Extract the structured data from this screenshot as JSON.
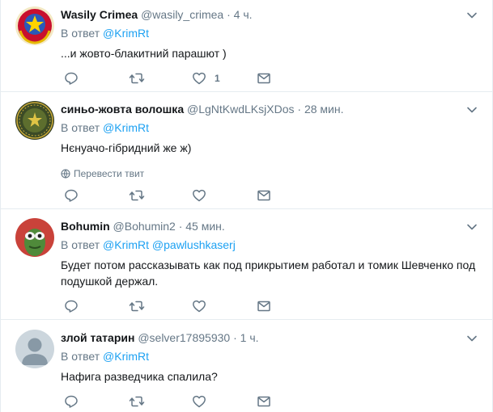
{
  "tweets": [
    {
      "name": "Wasily Crimea",
      "handle": "@wasily_crimea",
      "time": "4 ч.",
      "reply_prefix": "В ответ",
      "reply_to": [
        "@KrimRt"
      ],
      "text": "...и жовто-блакитний парашют )",
      "likes": "1"
    },
    {
      "name": "синьо-жовта волошка",
      "handle": "@LgNtKwdLKsjXDos",
      "time": "28 мин.",
      "reply_prefix": "В ответ",
      "reply_to": [
        "@KrimRt"
      ],
      "text": "Нєнуачо-гібридний же ж)",
      "translate": "Перевести твит"
    },
    {
      "name": "Bohumin",
      "handle": "@Bohumin2",
      "time": "45 мин.",
      "reply_prefix": "В ответ",
      "reply_to": [
        "@KrimRt",
        "@pawlushkaserj"
      ],
      "text": "Будет потом рассказывать как под прикрытием работал и томик Шевченко под подушкой держал."
    },
    {
      "name": "злой татарин",
      "handle": "@selver17895930",
      "time": "1 ч.",
      "reply_prefix": "В ответ",
      "reply_to": [
        "@KrimRt"
      ],
      "text": "Нафига разведчика спалила?"
    }
  ],
  "separator": "·",
  "colors": {
    "text": "#14171a",
    "secondary": "#657786",
    "link": "#1da1f2",
    "border": "#e6ecf0"
  },
  "icons": {
    "reply": "reply-icon",
    "retweet": "retweet-icon",
    "like": "heart-icon",
    "dm": "envelope-icon",
    "more": "chevron-down-icon",
    "translate": "globe-icon"
  }
}
